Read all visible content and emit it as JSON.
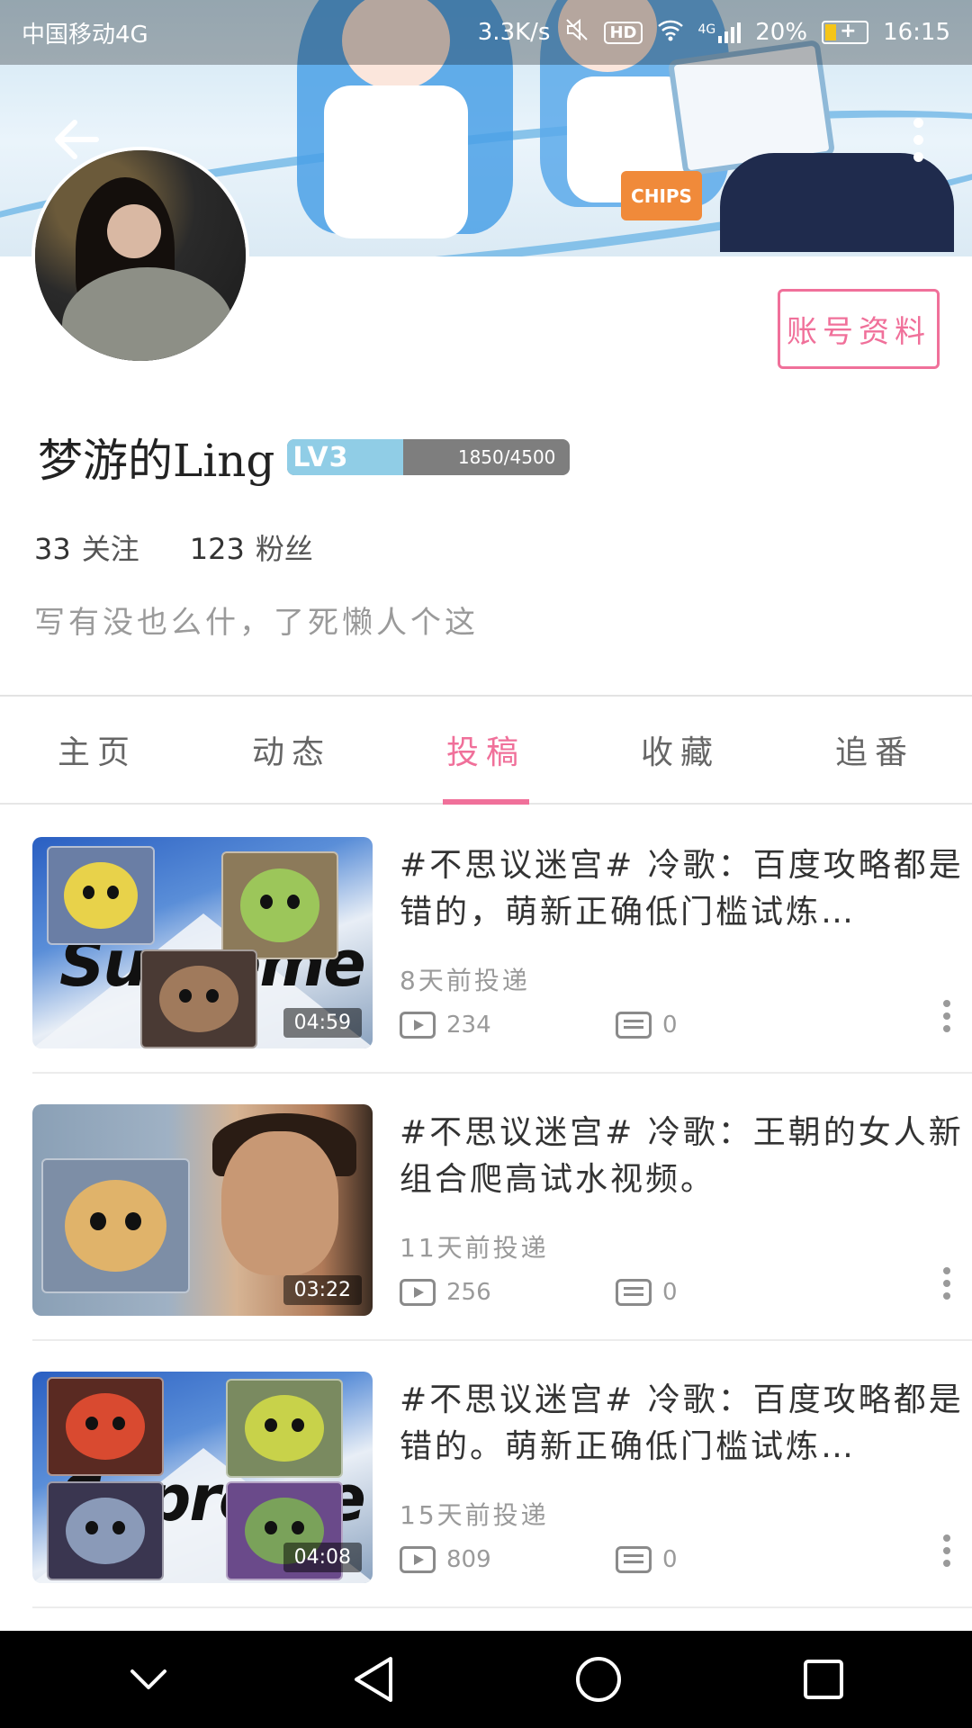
{
  "status_bar": {
    "carrier": "中国移动4G",
    "net_speed": "3.3K/s",
    "hd": "HD",
    "signal": "4G",
    "battery": "20%",
    "time": "16:15"
  },
  "banner": {
    "sticker_text": "CHIPS"
  },
  "profile": {
    "name": "梦游的Ling",
    "level": "LV3",
    "xp": "1850/4500",
    "xp_fraction": 0.411,
    "following_count": "33",
    "following_label": "关注",
    "followers_count": "123",
    "followers_label": "粉丝",
    "signature": "写有没也么什，了死懒人个这",
    "account_button": "账号资料"
  },
  "tabs": [
    {
      "label": "主页",
      "active": false
    },
    {
      "label": "动态",
      "active": false
    },
    {
      "label": "投稿",
      "active": true
    },
    {
      "label": "收藏",
      "active": false
    },
    {
      "label": "追番",
      "active": false
    }
  ],
  "videos": [
    {
      "title": "#不思议迷宫# 冷歌：百度攻略都是错的，萌新正确低门槛试炼…",
      "time": "8天前投递",
      "duration": "04:59",
      "plays": "234",
      "danmaku": "0",
      "thumb_style": "supreme"
    },
    {
      "title": "#不思议迷宫# 冷歌：王朝的女人新组合爬高试水视频。",
      "time": "11天前投递",
      "duration": "03:22",
      "plays": "256",
      "danmaku": "0",
      "thumb_style": "portrait"
    },
    {
      "title": "#不思议迷宫# 冷歌：百度攻略都是错的。萌新正确低门槛试炼…",
      "time": "15天前投递",
      "duration": "04:08",
      "plays": "809",
      "danmaku": "0",
      "thumb_style": "supreme"
    }
  ],
  "colors": {
    "accent": "#f0709a",
    "level_fill": "#90cde6",
    "level_track": "#7e7e7e"
  }
}
